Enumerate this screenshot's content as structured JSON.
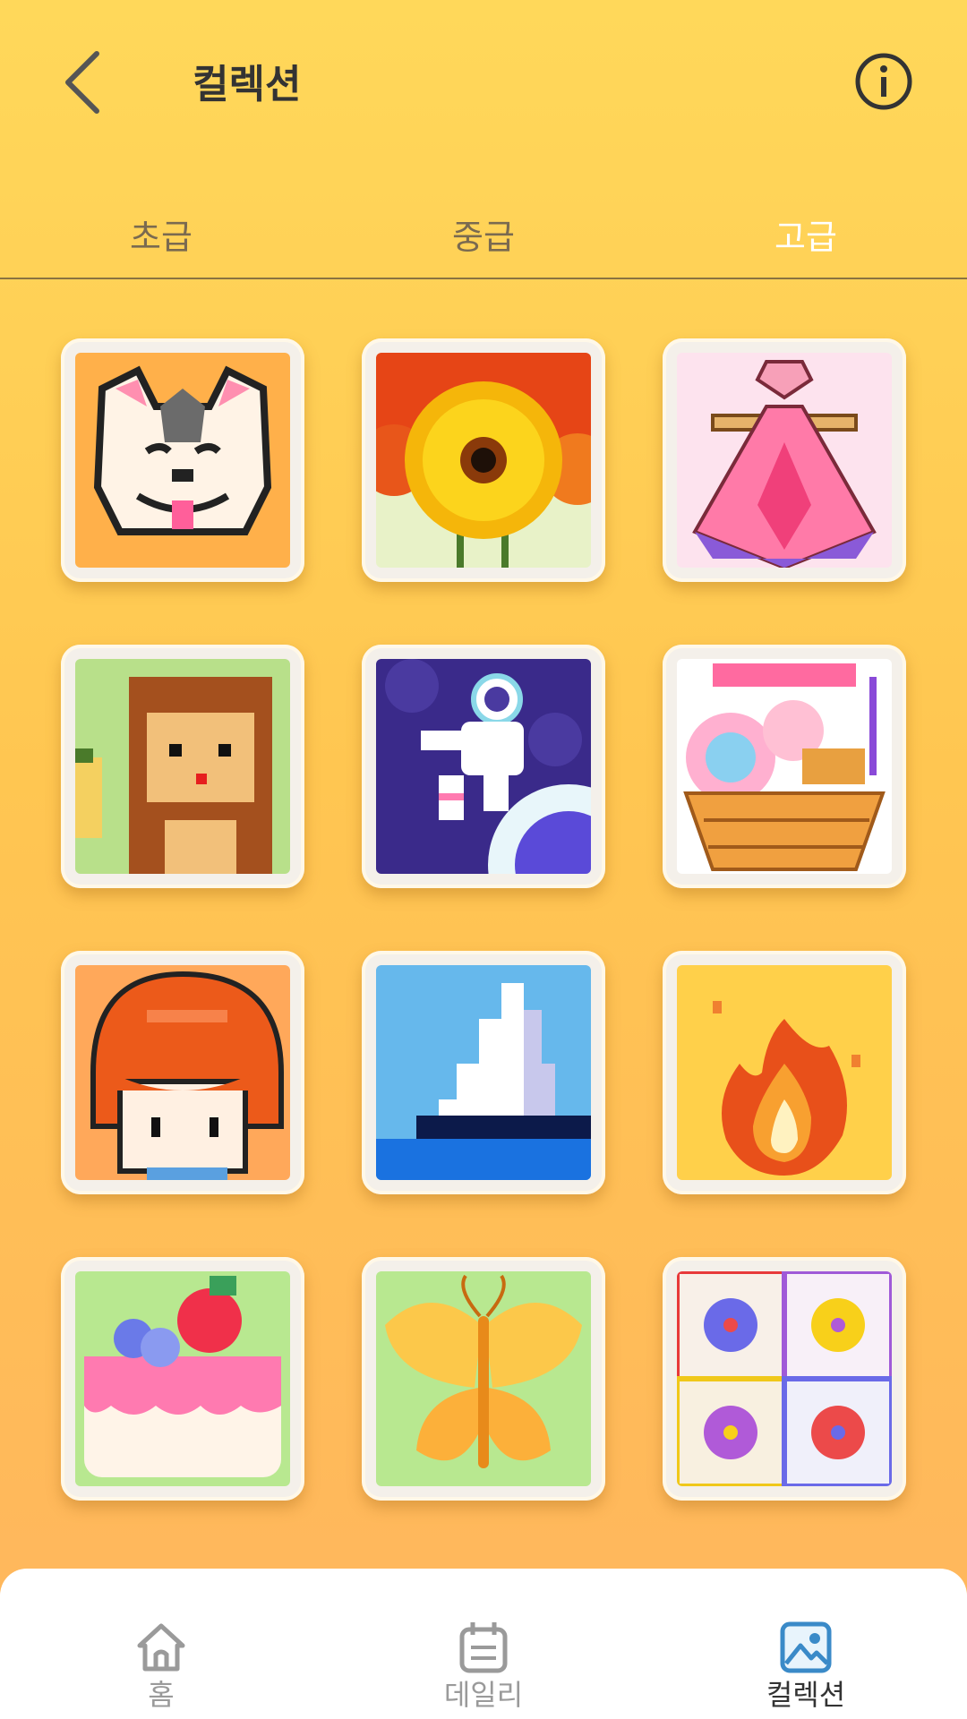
{
  "header": {
    "title": "컬렉션"
  },
  "tabs": [
    {
      "label": "초급"
    },
    {
      "label": "중급"
    },
    {
      "label": "고급"
    }
  ],
  "active_tab": "고급",
  "gallery": {
    "items": [
      {
        "name": "dog"
      },
      {
        "name": "sunflower"
      },
      {
        "name": "perfume-bottle"
      },
      {
        "name": "monkey"
      },
      {
        "name": "astronaut"
      },
      {
        "name": "gift-basket"
      },
      {
        "name": "boy"
      },
      {
        "name": "iceberg"
      },
      {
        "name": "fire"
      },
      {
        "name": "cake"
      },
      {
        "name": "butterfly"
      },
      {
        "name": "flower-tiles"
      }
    ]
  },
  "bottom_nav": {
    "items": [
      {
        "label": "홈",
        "icon": "home-icon"
      },
      {
        "label": "데일리",
        "icon": "calendar-icon"
      },
      {
        "label": "컬렉션",
        "icon": "gallery-icon"
      }
    ],
    "active": "컬렉션"
  },
  "colors": {
    "accent": "#ffc651",
    "active_tab_text": "#ffffff"
  }
}
